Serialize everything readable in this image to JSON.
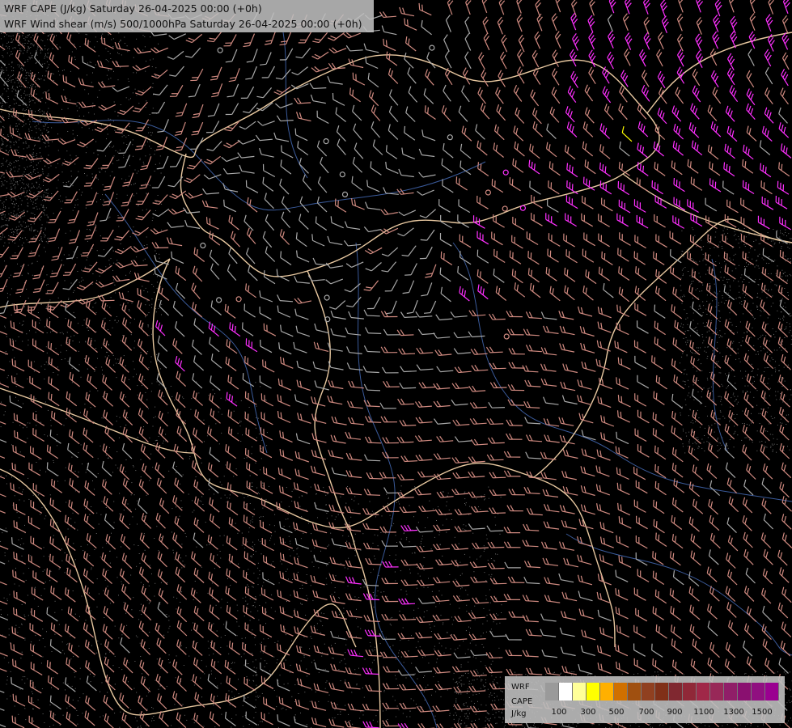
{
  "header": {
    "line1": "WRF CAPE (J/kg) Saturday 26-04-2025 00:00 (+0h)",
    "line2": "WRF Wind shear (m/s) 500/1000hPa Saturday 26-04-2025 00:00 (+0h)"
  },
  "legend": {
    "label_lines": [
      "WRF",
      "CAPE",
      "J/kg"
    ],
    "colors": [
      "#9a9a9a",
      "#ffffff",
      "#ffff99",
      "#ffff00",
      "#ffb000",
      "#d07000",
      "#a05010",
      "#904020",
      "#803018",
      "#802830",
      "#902838",
      "#a02848",
      "#982858",
      "#901e68",
      "#8a1070",
      "#901080",
      "#9a0090"
    ],
    "ticks": [
      "100",
      "300",
      "500",
      "700",
      "900",
      "1100",
      "1300",
      "1500"
    ]
  },
  "colors": {
    "background": "#000000",
    "border": "#e8c8a0",
    "river": "#3a5a9a",
    "barb_low": "#a8a8a8",
    "barb_mid": "#d08a80",
    "barb_high": "#ff30ff",
    "cape_yellow": "#ffff00"
  }
}
